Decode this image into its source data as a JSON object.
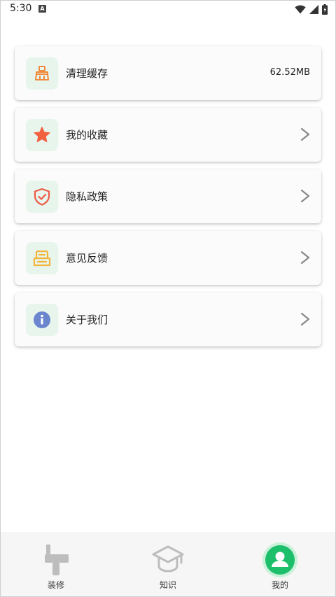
{
  "status_bar": {
    "time": "5:30",
    "badge": "A"
  },
  "menu": [
    {
      "label": "清理缓存",
      "value": "62.52MB",
      "icon": "broom-icon"
    },
    {
      "label": "我的收藏",
      "icon": "star-icon"
    },
    {
      "label": "隐私政策",
      "icon": "shield-check-icon"
    },
    {
      "label": "意见反馈",
      "icon": "feedback-icon"
    },
    {
      "label": "关于我们",
      "icon": "info-icon"
    }
  ],
  "bottom_nav": [
    {
      "label": "装修",
      "icon": "paint-roller-icon",
      "active": false
    },
    {
      "label": "知识",
      "icon": "graduation-cap-icon",
      "active": false
    },
    {
      "label": "我的",
      "icon": "user-icon",
      "active": true
    }
  ],
  "colors": {
    "accent": "#1dbf6a",
    "icon_bg": "#e8f5ed",
    "broom": "#f08a3c",
    "star": "#f2613f",
    "shield": "#ee5a45",
    "feedback": "#f2b53a",
    "info": "#6b86cf",
    "nav_inactive": "#bdbdbd"
  }
}
